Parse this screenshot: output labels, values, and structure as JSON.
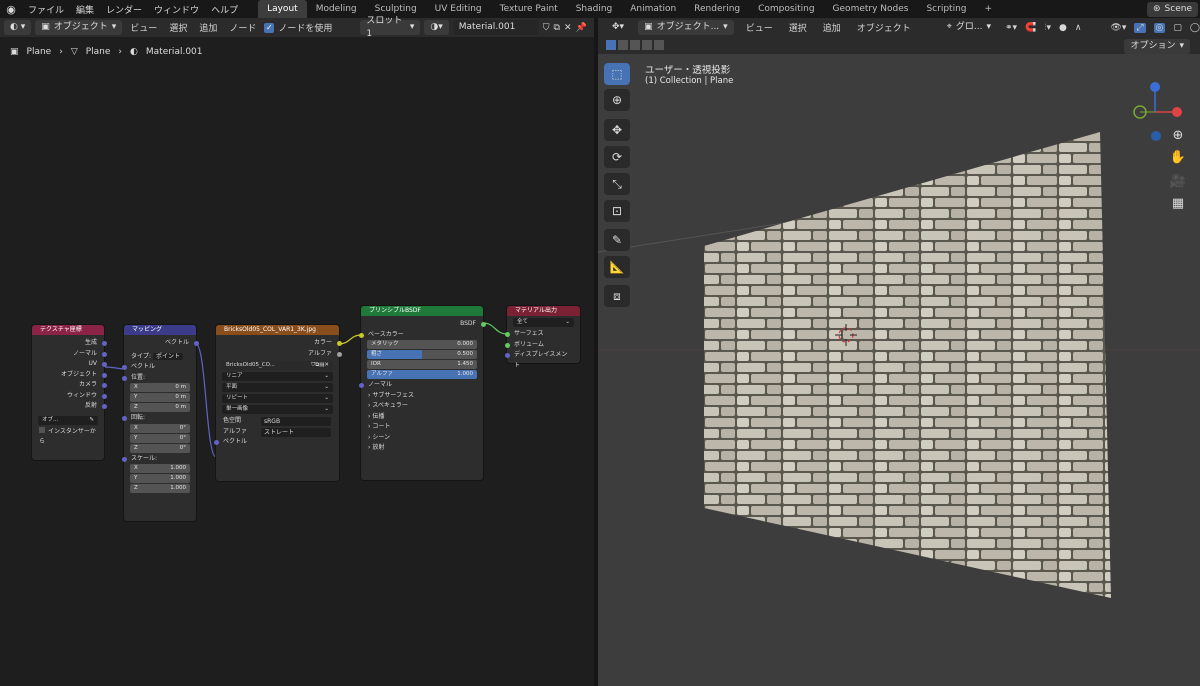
{
  "topbar": {
    "menus": [
      "ファイル",
      "編集",
      "レンダー",
      "ウィンドウ",
      "ヘルプ"
    ],
    "tabs": [
      "Layout",
      "Modeling",
      "Sculpting",
      "UV Editing",
      "Texture Paint",
      "Shading",
      "Animation",
      "Rendering",
      "Compositing",
      "Geometry Nodes",
      "Scripting"
    ],
    "add_tab": "+",
    "scene": "Scene"
  },
  "node_editor": {
    "mode": "オブジェクト",
    "menus": [
      "ビュー",
      "選択",
      "追加",
      "ノード"
    ],
    "use_nodes_label": "ノードを使用",
    "slot": "スロット1",
    "material": "Material.001",
    "breadcrumb": [
      "Plane",
      "Plane",
      "Material.001"
    ]
  },
  "nodes": {
    "texcoord": {
      "title": "テクスチャ座標",
      "outputs": [
        "生成",
        "ノーマル",
        "UV",
        "オブジェクト",
        "カメラ",
        "ウィンドウ",
        "反射"
      ],
      "object_label": "オブ...",
      "from_instancer": "インスタンサーから"
    },
    "mapping": {
      "title": "マッピング",
      "output": "ベクトル",
      "type_label": "タイプ:",
      "type_value": "ポイント",
      "input": "ベクトル",
      "location": "位置:",
      "rotation": "回転:",
      "scale": "スケール:",
      "loc": [
        [
          "X",
          "0 m"
        ],
        [
          "Y",
          "0 m"
        ],
        [
          "Z",
          "0 m"
        ]
      ],
      "rot": [
        [
          "X",
          "0°"
        ],
        [
          "Y",
          "0°"
        ],
        [
          "Z",
          "0°"
        ]
      ],
      "scl": [
        [
          "X",
          "1.000"
        ],
        [
          "Y",
          "1.000"
        ],
        [
          "Z",
          "1.000"
        ]
      ]
    },
    "image": {
      "title": "BricksOld05_COL_VAR1_3K.jpg",
      "out_color": "カラー",
      "out_alpha": "アルファ",
      "image_name": "BricksOld05_CO...",
      "interp": "リニア",
      "proj": "平面",
      "ext": "リピート",
      "source": "単一画像",
      "colorspace_label": "色空間",
      "colorspace": "sRGB",
      "alpha_label": "アルファ",
      "alpha": "ストレート",
      "vector": "ベクトル"
    },
    "bsdf": {
      "title": "プリンシプルBSDF",
      "out": "BSDF",
      "base_color": "ベースカラー",
      "fields": [
        [
          "メタリック",
          "0.000"
        ],
        [
          "粗さ",
          "0.500"
        ],
        [
          "IOR",
          "1.450"
        ],
        [
          "アルファ",
          "1.000"
        ]
      ],
      "normal": "ノーマル",
      "panels": [
        "サブサーフェス",
        "スペキュラー",
        "伝播",
        "コート",
        "シーン",
        "放射"
      ]
    },
    "output": {
      "title": "マテリアル出力",
      "target": "全て",
      "inputs": [
        "サーフェス",
        "ボリューム",
        "ディスプレイスメント"
      ]
    }
  },
  "viewport": {
    "mode": "オブジェクト...",
    "menus": [
      "ビュー",
      "選択",
      "追加",
      "オブジェクト"
    ],
    "orientation": "グロ...",
    "options": "オプション",
    "view_name": "ユーザー・透視投影",
    "collection": "(1) Collection | Plane"
  }
}
